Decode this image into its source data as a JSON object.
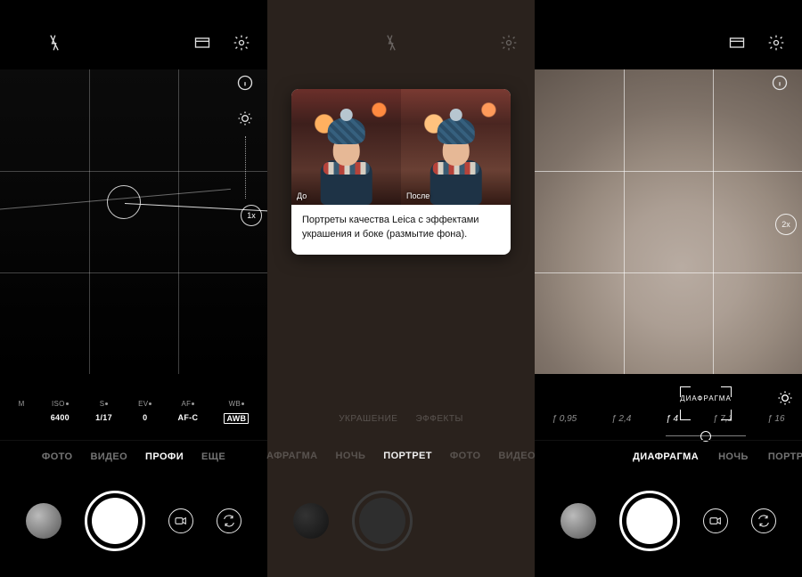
{
  "panel1": {
    "zoom": "1x",
    "pro": {
      "c1_lbl": "M",
      "c1_val": "6400",
      "c1_hdr": "ISO",
      "c2_lbl": "S",
      "c2_val": "1/17",
      "c3_lbl": "EV",
      "c3_val": "0",
      "c4_lbl": "AF",
      "c4_val": "AF-C",
      "c5_lbl": "WB",
      "c5_val": "AWB"
    },
    "modes": {
      "m1": "ФОТО",
      "m2": "ВИДЕО",
      "m3": "ПРОФИ",
      "m4": "ЕЩЕ"
    }
  },
  "panel2": {
    "popup": {
      "before": "До",
      "after": "После",
      "text": "Портреты качества Leica с эффектами украшения и боке (размытие фона)."
    },
    "midtabs": {
      "t1": "УКРАШЕНИЕ",
      "t2": "ЭФФЕКТЫ"
    },
    "modes": {
      "m1": "АФРАГМА",
      "m2": "НОЧЬ",
      "m3": "ПОРТРЕТ",
      "m4": "ФОТО",
      "m5": "ВИДЕО"
    }
  },
  "panel3": {
    "zoom": "2x",
    "aperture_label": "ДИАФРАГМА",
    "apertures": {
      "a1": "ƒ 0,95",
      "a2": "ƒ 2,4",
      "a3": "ƒ 4",
      "a4": "ƒ 7,1",
      "a5": "ƒ 16"
    },
    "modes": {
      "m1": "ДИАФРАГМА",
      "m2": "НОЧЬ",
      "m3": "ПОРТРЕ"
    }
  }
}
